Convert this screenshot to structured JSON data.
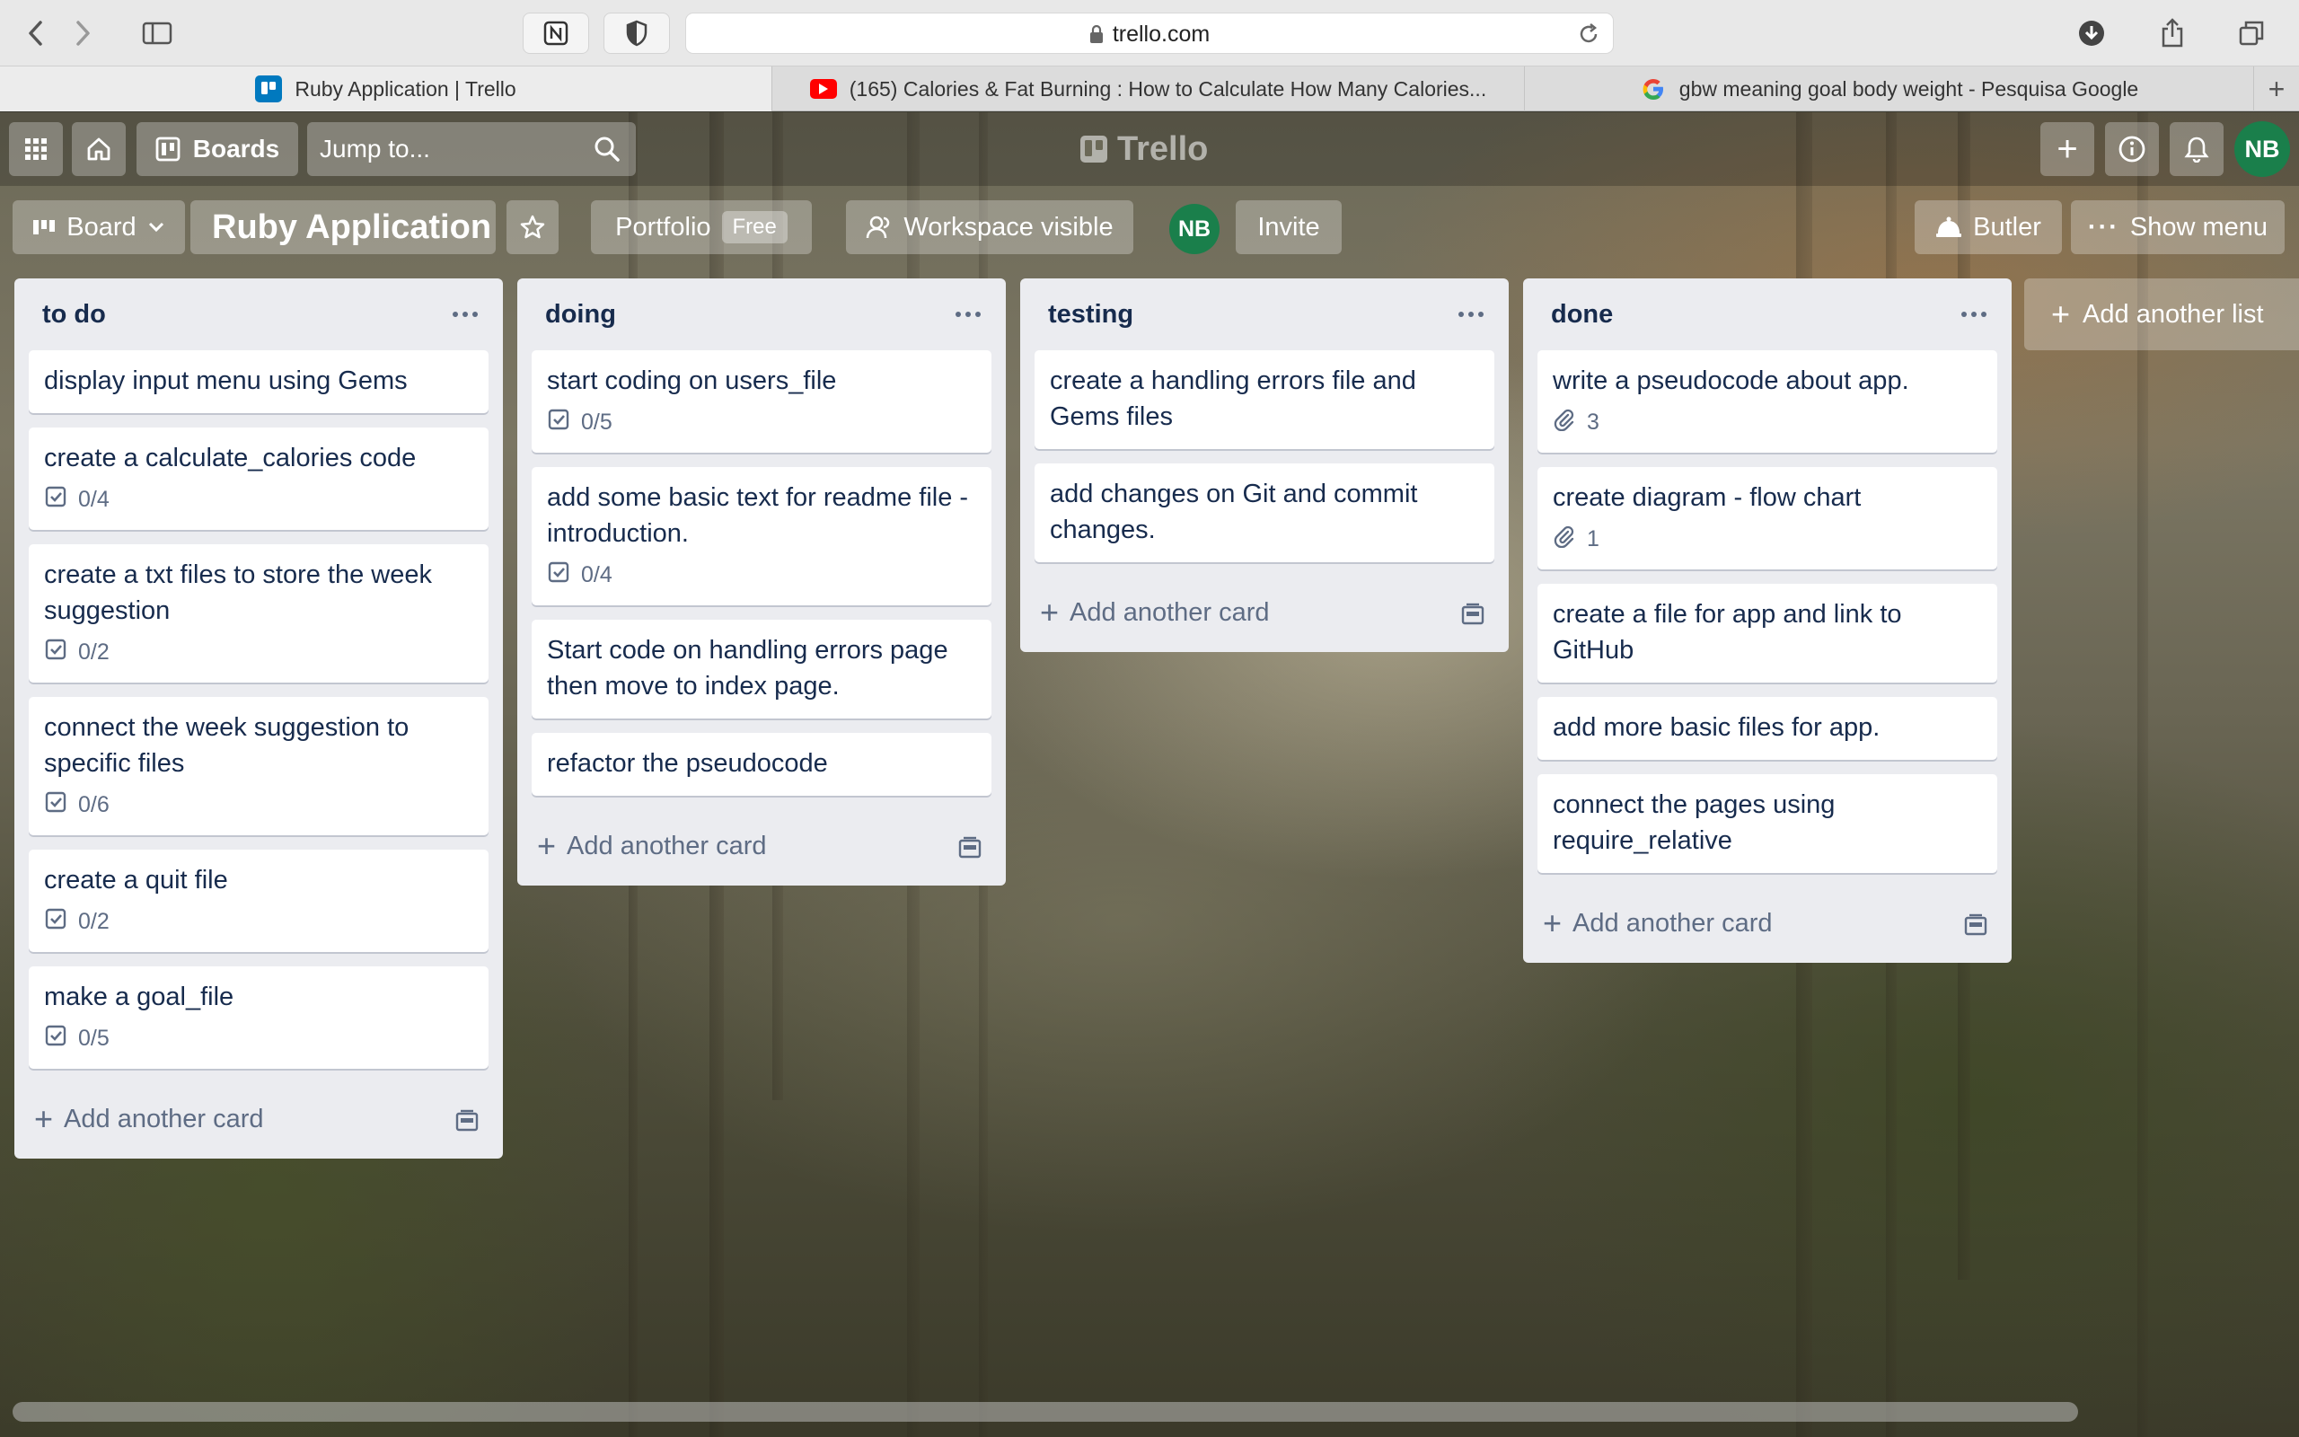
{
  "browser": {
    "url": "trello.com",
    "tabs": [
      {
        "title": "Ruby Application | Trello",
        "active": true,
        "favicon": "trello-icon"
      },
      {
        "title": "(165) Calories & Fat Burning : How to Calculate How Many Calories...",
        "active": false,
        "favicon": "youtube-icon"
      },
      {
        "title": "gbw meaning goal body weight - Pesquisa Google",
        "active": false,
        "favicon": "google-icon"
      }
    ]
  },
  "header": {
    "boards_label": "Boards",
    "jump_placeholder": "Jump to...",
    "logo_text": "Trello",
    "user_initials": "NB"
  },
  "board": {
    "view_label": "Board",
    "title": "Ruby Application",
    "portfolio_label": "Portfolio",
    "portfolio_badge": "Free",
    "visibility_label": "Workspace visible",
    "member_initials": "NB",
    "invite_label": "Invite",
    "butler_label": "Butler",
    "show_menu_label": "Show menu"
  },
  "lists": [
    {
      "title": "to do",
      "cards": [
        {
          "title": "display input menu using Gems"
        },
        {
          "title": "create a calculate_calories code",
          "badge_type": "checklist",
          "badge": "0/4"
        },
        {
          "title": "create a txt files to store the week suggestion",
          "badge_type": "checklist",
          "badge": "0/2"
        },
        {
          "title": "connect the week suggestion to specific files",
          "badge_type": "checklist",
          "badge": "0/6"
        },
        {
          "title": "create a quit file",
          "badge_type": "checklist",
          "badge": "0/2"
        },
        {
          "title": "make a goal_file",
          "badge_type": "checklist",
          "badge": "0/5"
        }
      ]
    },
    {
      "title": "doing",
      "cards": [
        {
          "title": "start coding on users_file",
          "badge_type": "checklist",
          "badge": "0/5"
        },
        {
          "title": "add some basic text for readme file - introduction.",
          "badge_type": "checklist",
          "badge": "0/4"
        },
        {
          "title": "Start code on handling errors page then move to index page."
        },
        {
          "title": "refactor the pseudocode"
        }
      ]
    },
    {
      "title": "testing",
      "cards": [
        {
          "title": "create a handling errors file and Gems files"
        },
        {
          "title": "add changes on Git and commit changes."
        }
      ]
    },
    {
      "title": "done",
      "cards": [
        {
          "title": "write a pseudocode about app.",
          "badge_type": "attachment",
          "badge": "3"
        },
        {
          "title": "create diagram - flow chart",
          "badge_type": "attachment",
          "badge": "1"
        },
        {
          "title": "create a file for app and link to GitHub"
        },
        {
          "title": "add more basic files for app."
        },
        {
          "title": "connect the pages using require_relative"
        }
      ]
    }
  ],
  "add_card_label": "Add another card",
  "add_list_label": "Add another list",
  "colors": {
    "avatar": "#1a7f4b",
    "list_bg": "#ebecf0",
    "text": "#172b4d",
    "muted": "#5e6c84"
  }
}
